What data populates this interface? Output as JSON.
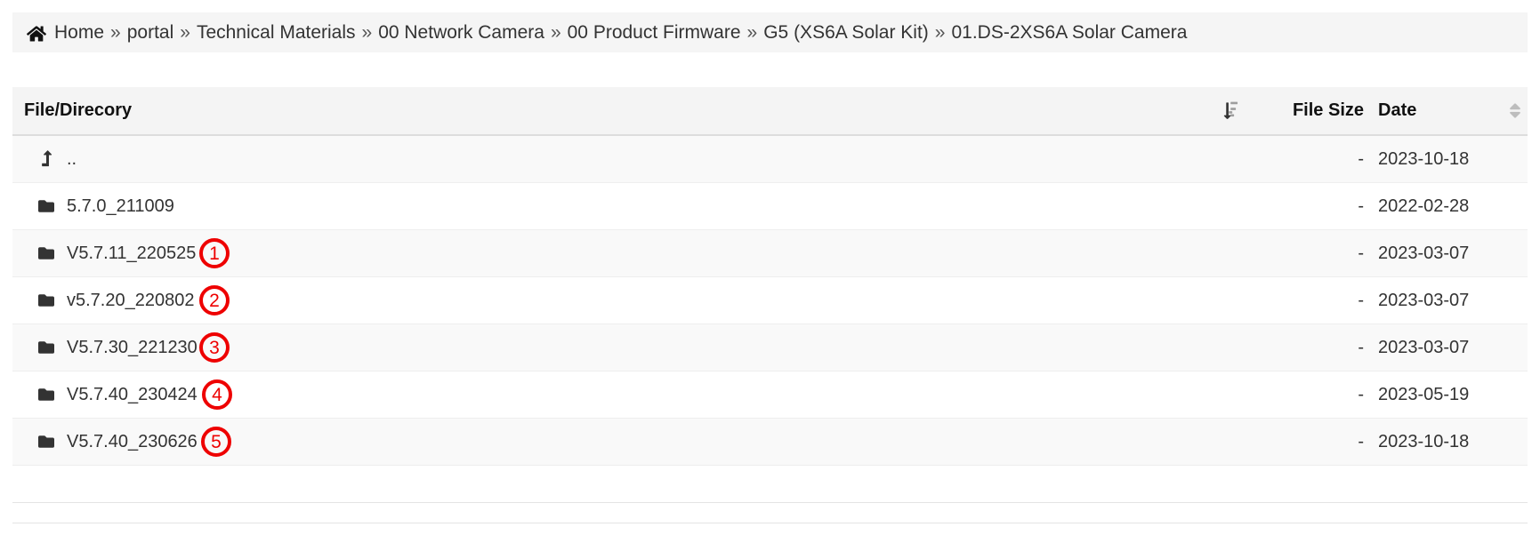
{
  "breadcrumb": {
    "home_icon": "home-icon",
    "separator": "»",
    "items": [
      {
        "label": "Home"
      },
      {
        "label": "portal"
      },
      {
        "label": "Technical Materials"
      },
      {
        "label": "00 Network Camera"
      },
      {
        "label": "00 Product Firmware"
      },
      {
        "label": "G5 (XS6A Solar Kit)"
      },
      {
        "label": "01.DS-2XS6A Solar Camera"
      }
    ]
  },
  "table": {
    "headers": {
      "name": "File/Direcory",
      "size": "File Size",
      "date": "Date",
      "name_sort_icon": "sort-amount-down-icon",
      "date_sort_icon": "sort-updown-icon"
    },
    "rows": [
      {
        "icon": "level-up-icon",
        "name": "..",
        "size": "-",
        "date": "2023-10-18",
        "badge": null
      },
      {
        "icon": "folder-icon",
        "name": "5.7.0_211009",
        "size": "-",
        "date": "2022-02-28",
        "badge": null
      },
      {
        "icon": "folder-icon",
        "name": "V5.7.11_220525",
        "size": "-",
        "date": "2023-03-07",
        "badge": "1"
      },
      {
        "icon": "folder-icon",
        "name": "v5.7.20_220802",
        "size": "-",
        "date": "2023-03-07",
        "badge": "2"
      },
      {
        "icon": "folder-icon",
        "name": "V5.7.30_221230",
        "size": "-",
        "date": "2023-03-07",
        "badge": "3"
      },
      {
        "icon": "folder-icon",
        "name": "V5.7.40_230424",
        "size": "-",
        "date": "2023-05-19",
        "badge": "4"
      },
      {
        "icon": "folder-icon",
        "name": "V5.7.40_230626",
        "size": "-",
        "date": "2023-10-18",
        "badge": "5"
      }
    ]
  },
  "colors": {
    "annotation": "#ee0000",
    "header_bg": "#f4f4f4",
    "breadcrumb_bg": "#f5f5f5",
    "row_alt_bg": "#f9f9f9",
    "text": "#333333"
  }
}
